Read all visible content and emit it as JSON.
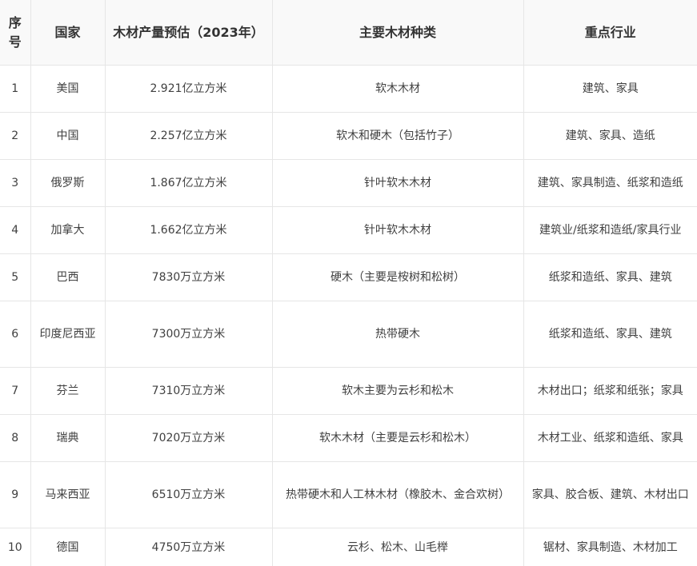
{
  "table": {
    "headers": [
      "序号",
      "国家",
      "木材产量预估（2023年）",
      "主要木材种类",
      "重点行业"
    ],
    "rows": [
      {
        "no": "1",
        "country": "美国",
        "output": "2.921亿立方米",
        "wood": "软木木材",
        "industry": "建筑、家具"
      },
      {
        "no": "2",
        "country": "中国",
        "output": "2.257亿立方米",
        "wood": "软木和硬木（包括竹子）",
        "industry": "建筑、家具、造纸"
      },
      {
        "no": "3",
        "country": "俄罗斯",
        "output": "1.867亿立方米",
        "wood": "针叶软木木材",
        "industry": "建筑、家具制造、纸浆和造纸"
      },
      {
        "no": "4",
        "country": "加拿大",
        "output": "1.662亿立方米",
        "wood": "针叶软木木材",
        "industry": "建筑业/纸浆和造纸/家具行业"
      },
      {
        "no": "5",
        "country": "巴西",
        "output": "7830万立方米",
        "wood": "硬木（主要是桉树和松树）",
        "industry": "纸浆和造纸、家具、建筑"
      },
      {
        "no": "6",
        "country": "印度尼西亚",
        "output": "7300万立方米",
        "wood": "热带硬木",
        "industry": "纸浆和造纸、家具、建筑"
      },
      {
        "no": "7",
        "country": "芬兰",
        "output": "7310万立方米",
        "wood": "软木主要为云杉和松木",
        "industry": "木材出口；纸浆和纸张；家具"
      },
      {
        "no": "8",
        "country": "瑞典",
        "output": "7020万立方米",
        "wood": "软木木材（主要是云杉和松木）",
        "industry": "木材工业、纸浆和造纸、家具"
      },
      {
        "no": "9",
        "country": "马来西亚",
        "output": "6510万立方米",
        "wood": "热带硬木和人工林木材（橡胶木、金合欢树）",
        "industry": "家具、胶合板、建筑、木材出口"
      },
      {
        "no": "10",
        "country": "德国",
        "output": "4750万立方米",
        "wood": "云杉、松木、山毛榉",
        "industry": "锯材、家具制造、木材加工"
      }
    ]
  }
}
